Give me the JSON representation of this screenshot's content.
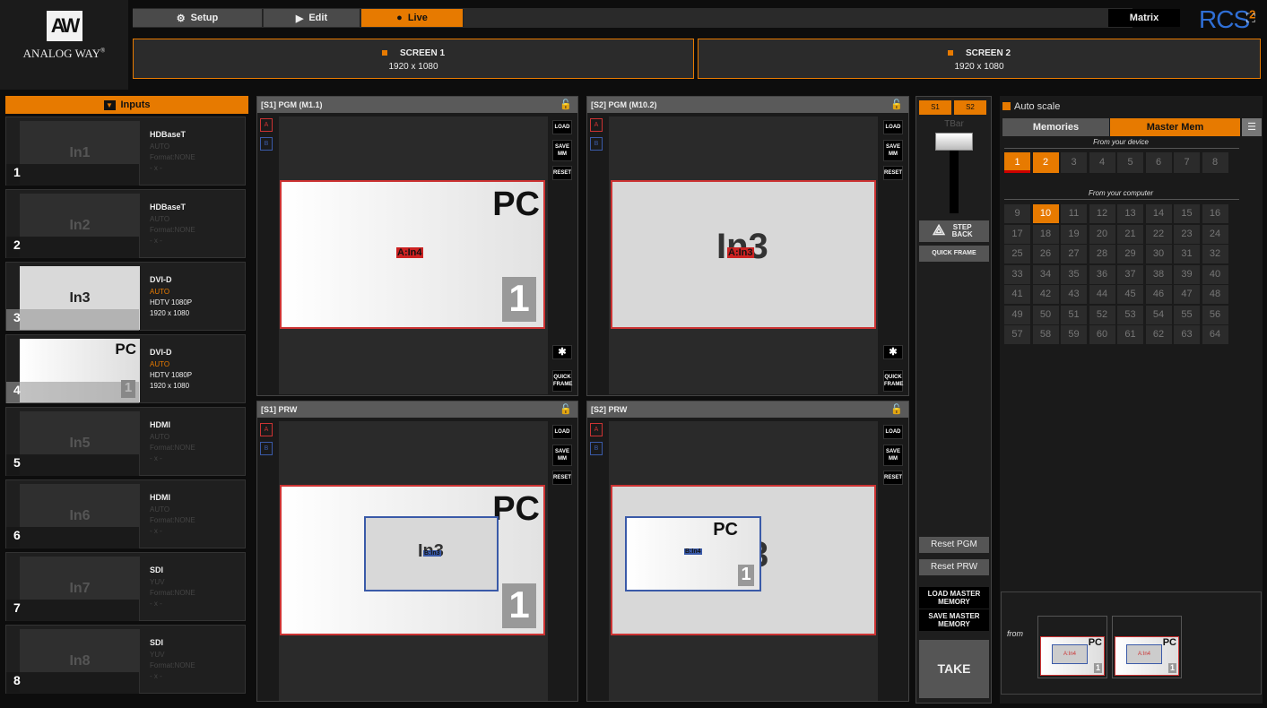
{
  "brand": {
    "logo_text": "ANALOG WAY",
    "reg": "®"
  },
  "modes": [
    {
      "label": "Setup",
      "icon": "gear-icon"
    },
    {
      "label": "Edit",
      "icon": "play-icon"
    },
    {
      "label": "Live",
      "icon": "record-icon"
    }
  ],
  "header": {
    "matrix_label": "Matrix",
    "rcs": "RCS",
    "rcs_sup": "2"
  },
  "screens": [
    {
      "title": "SCREEN 1",
      "res": "1920 x 1080"
    },
    {
      "title": "SCREEN 2",
      "res": "1920 x 1080"
    }
  ],
  "inputs_panel": {
    "title": "Inputs"
  },
  "inputs": [
    {
      "num": "1",
      "thumb": "In1",
      "type": "HDBaseT",
      "l1": "AUTO",
      "l2": "Format:NONE",
      "l3": "- x -"
    },
    {
      "num": "2",
      "thumb": "In2",
      "type": "HDBaseT",
      "l1": "AUTO",
      "l2": "Format:NONE",
      "l3": "- x -"
    },
    {
      "num": "3",
      "thumb": "In3",
      "type": "DVI-D",
      "l1": "AUTO",
      "l2": "HDTV 1080P",
      "l3": "1920 x 1080"
    },
    {
      "num": "4",
      "thumb": "PC",
      "thumb_badge": "1",
      "type": "DVI-D",
      "l1": "AUTO",
      "l2": "HDTV 1080P",
      "l3": "1920 x 1080"
    },
    {
      "num": "5",
      "thumb": "In5",
      "type": "HDMI",
      "l1": "AUTO",
      "l2": "Format:NONE",
      "l3": "- x -"
    },
    {
      "num": "6",
      "thumb": "In6",
      "type": "HDMI",
      "l1": "AUTO",
      "l2": "Format:NONE",
      "l3": "- x -"
    },
    {
      "num": "7",
      "thumb": "In7",
      "type": "SDI",
      "l1": "YUV",
      "l2": "Format:NONE",
      "l3": "- x -"
    },
    {
      "num": "8",
      "thumb": "In8",
      "type": "SDI",
      "l1": "YUV",
      "l2": "Format:NONE",
      "l3": "- x -"
    }
  ],
  "panels": {
    "s1pgm": {
      "title": "[S1] PGM (M1.1)",
      "pc": "PC",
      "badge": "1",
      "label": "A:In4"
    },
    "s2pgm": {
      "title": "[S2] PGM (M10.2)",
      "content": "In3",
      "label": "A:In3"
    },
    "s1prw": {
      "title": "[S1] PRW",
      "pc": "PC",
      "badge": "1",
      "inner": "In3",
      "inner_label": "B:In3"
    },
    "s2prw": {
      "title": "[S2] PRW",
      "pc": "PC",
      "badge": "1",
      "behind": "3",
      "inner_label": "B:In4"
    }
  },
  "panel_buttons": {
    "a": "A",
    "b": "B",
    "load": "LOAD",
    "save": "SAVE MM",
    "reset": "RESET",
    "quick": "QUICK FRAME"
  },
  "center": {
    "s1": "S1",
    "s2": "S2",
    "tbar": "TBar",
    "step_back": "STEP BACK",
    "quick_frame": "QUICK FRAME",
    "reset_pgm": "Reset PGM",
    "reset_prw": "Reset PRW",
    "load_mm": "LOAD MASTER MEMORY",
    "save_mm": "SAVE MASTER MEMORY",
    "take": "TAKE"
  },
  "right": {
    "auto_scale": "Auto scale",
    "tab_memories": "Memories",
    "tab_master": "Master Mem",
    "from_device": "From your device",
    "from_computer": "From your computer",
    "from": "from",
    "thumb_pc": "PC",
    "thumb_label": "A:In4",
    "thumb_badge": "1"
  },
  "device_memories": [
    "1",
    "2",
    "3",
    "4",
    "5",
    "6",
    "7",
    "8"
  ],
  "computer_memories": [
    "9",
    "10",
    "11",
    "12",
    "13",
    "14",
    "15",
    "16",
    "17",
    "18",
    "19",
    "20",
    "21",
    "22",
    "23",
    "24",
    "25",
    "26",
    "27",
    "28",
    "29",
    "30",
    "31",
    "32",
    "33",
    "34",
    "35",
    "36",
    "37",
    "38",
    "39",
    "40",
    "41",
    "42",
    "43",
    "44",
    "45",
    "46",
    "47",
    "48",
    "49",
    "50",
    "51",
    "52",
    "53",
    "54",
    "55",
    "56",
    "57",
    "58",
    "59",
    "60",
    "61",
    "62",
    "63",
    "64"
  ],
  "colors": {
    "accent": "#e77a00",
    "source_a": "#cc3333",
    "source_b": "#3a5aa8"
  }
}
